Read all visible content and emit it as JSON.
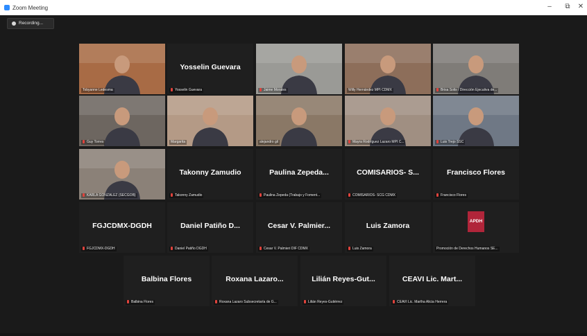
{
  "window": {
    "title": "Zoom Meeting",
    "minimize": "–",
    "maximize": "⧉",
    "close": "✕"
  },
  "recording": {
    "label": "Recording..."
  },
  "participants": [
    {
      "display": "",
      "name": "Tobyanne Ledesma",
      "muted": false,
      "video": true,
      "active": true,
      "bg": "#a86b45"
    },
    {
      "display": "Yosselin Guevara",
      "name": "Yosselin Guevara",
      "muted": true,
      "video": false
    },
    {
      "display": "",
      "name": "Jaime Morales",
      "muted": true,
      "video": true,
      "bg": "#9a9a96"
    },
    {
      "display": "",
      "name": "Willy Hernández MPI CDMX",
      "muted": false,
      "video": true,
      "bg": "#8d6e5a"
    },
    {
      "display": "",
      "name": "Brisa Solis / Dirección Ejecutiva de...",
      "muted": true,
      "video": true,
      "bg": "#7f7c78"
    },
    {
      "display": "",
      "name": "Guy Torres",
      "muted": true,
      "video": true,
      "bg": "#6d6660"
    },
    {
      "display": "",
      "name": "Margarita",
      "muted": false,
      "video": true,
      "bg": "#b49a86"
    },
    {
      "display": "",
      "name": "alejandro gil",
      "muted": false,
      "video": true,
      "bg": "#8a7866"
    },
    {
      "display": "",
      "name": "Mayra Rodríguez Lazaro MPI C...",
      "muted": true,
      "video": true,
      "bg": "#a08f82"
    },
    {
      "display": "",
      "name": "Luis Trejo SSC",
      "muted": true,
      "video": true,
      "bg": "#6f7885"
    },
    {
      "display": "",
      "name": "KARLA GONZÁLEZ (SECGOB)",
      "muted": true,
      "video": true,
      "bg": "#8b8178"
    },
    {
      "display": "Takonny Zamudio",
      "name": "Takonny Zamudio",
      "muted": true,
      "video": false
    },
    {
      "display": "Paulina Zepeda...",
      "name": "Paulina Zepeda (Trabajo y Foment...",
      "muted": true,
      "video": false
    },
    {
      "display": "COMISARIOS- S...",
      "name": "COMISARIOS- SCG CDMX",
      "muted": true,
      "video": false
    },
    {
      "display": "Francisco Flores",
      "name": "Francisco Flores",
      "muted": true,
      "video": false
    },
    {
      "display": "FGJCDMX-DGDH",
      "name": "FGJCDMX-DGDH",
      "muted": true,
      "video": false
    },
    {
      "display": "Daniel Patiño D...",
      "name": "Daniel Patiño DGDH",
      "muted": true,
      "video": false
    },
    {
      "display": "Cesar V. Palmier...",
      "name": "Cesar V. Palmieri DIF CDMX",
      "muted": true,
      "video": false
    },
    {
      "display": "Luis Zamora",
      "name": "Luis Zamora",
      "muted": true,
      "video": false
    },
    {
      "display": "APDH",
      "name": "Promoción de Derechos Humanos SE...",
      "muted": false,
      "video": false,
      "logo": true
    },
    {
      "display": "Balbina Flores",
      "name": "Balbina Flores",
      "muted": true,
      "video": false
    },
    {
      "display": "Roxana Lazaro...",
      "name": "Roxana Lazaro Subsecretaría de G...",
      "muted": true,
      "video": false
    },
    {
      "display": "Lilián Reyes-Gut...",
      "name": "Lilián Reyes-Gutiérrez",
      "muted": true,
      "video": false
    },
    {
      "display": "CEAVI Lic. Mart...",
      "name": "CEAVI Lic. Martha Alicia Herrera",
      "muted": true,
      "video": false
    }
  ],
  "colors": {
    "active_border": "#c9d95c",
    "mic_muted": "#e0433c",
    "apdh": "#b0253a"
  }
}
